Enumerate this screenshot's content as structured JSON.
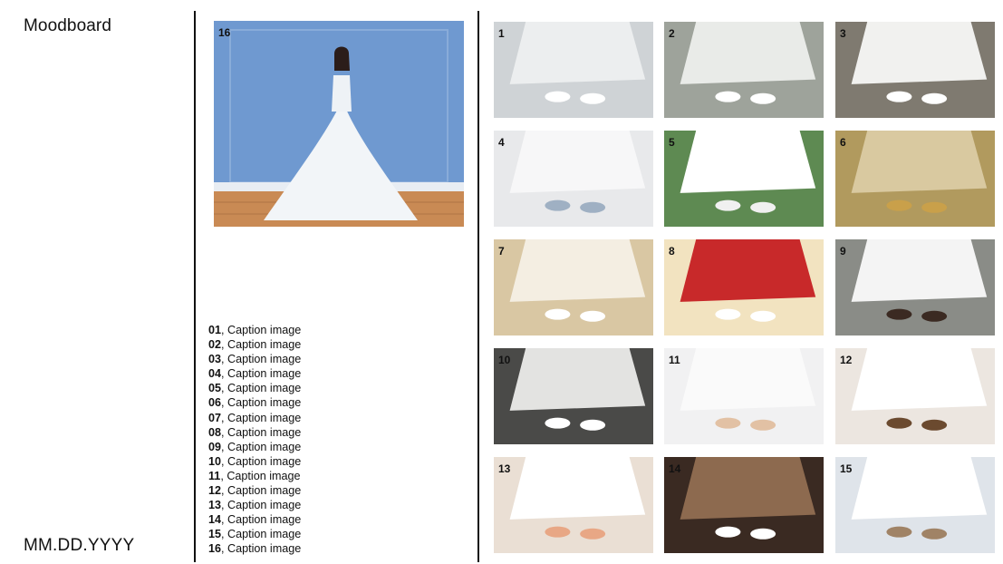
{
  "header": {
    "title": "Moodboard"
  },
  "footer": {
    "date": "MM.DD.YYYY"
  },
  "feature": {
    "number": "16"
  },
  "tiles": [
    {
      "number": "1"
    },
    {
      "number": "2"
    },
    {
      "number": "3"
    },
    {
      "number": "4"
    },
    {
      "number": "5"
    },
    {
      "number": "6"
    },
    {
      "number": "7"
    },
    {
      "number": "8"
    },
    {
      "number": "9"
    },
    {
      "number": "10"
    },
    {
      "number": "11"
    },
    {
      "number": "12"
    },
    {
      "number": "13"
    },
    {
      "number": "14"
    },
    {
      "number": "15"
    }
  ],
  "captions": [
    {
      "num": "01",
      "sep": ",",
      "text": " Caption image"
    },
    {
      "num": "02",
      "sep": ",",
      "text": " Caption image"
    },
    {
      "num": "03",
      "sep": ",",
      "text": " Caption image"
    },
    {
      "num": "04",
      "sep": ",",
      "text": " Caption image"
    },
    {
      "num": "05",
      "sep": ",",
      "text": " Caption image"
    },
    {
      "num": "06",
      "sep": ",",
      "text": " Caption image"
    },
    {
      "num": "07",
      "sep": ",",
      "text": " Caption image"
    },
    {
      "num": "08",
      "sep": ",",
      "text": " Caption image"
    },
    {
      "num": "09",
      "sep": ",",
      "text": " Caption image"
    },
    {
      "num": "10",
      "sep": ",",
      "text": " Caption image"
    },
    {
      "num": "11",
      "sep": ",",
      "text": " Caption image"
    },
    {
      "num": "12",
      "sep": ",",
      "text": " Caption image"
    },
    {
      "num": "13",
      "sep": ",",
      "text": " Caption image"
    },
    {
      "num": "14",
      "sep": ",",
      "text": " Caption image"
    },
    {
      "num": "15",
      "sep": ",",
      "text": " Caption image"
    },
    {
      "num": "16",
      "sep": ",",
      "text": " Caption image"
    }
  ]
}
